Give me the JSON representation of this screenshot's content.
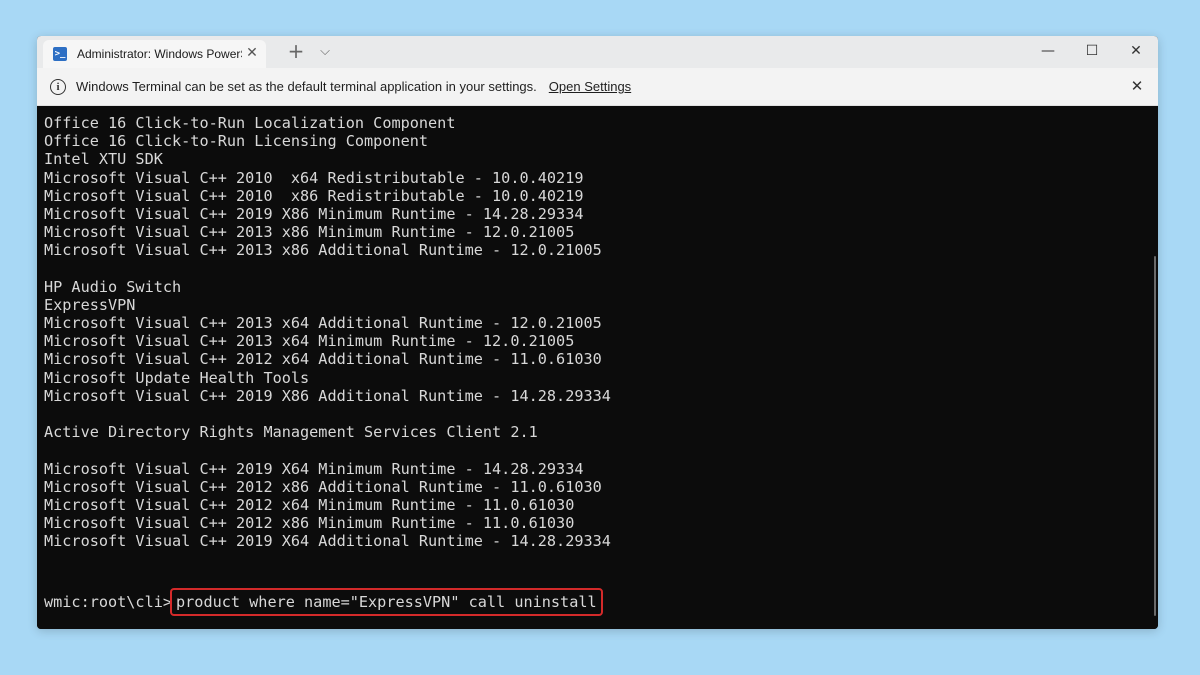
{
  "tab": {
    "title": "Administrator: Windows PowerShell",
    "close_glyph": "✕"
  },
  "titlebar": {
    "new_tab_glyph": "+",
    "dropdown_glyph": "⌵",
    "minimize_glyph": "—",
    "maximize_glyph": "☐",
    "close_glyph": "✕"
  },
  "infobar": {
    "icon_glyph": "i",
    "message": "Windows Terminal can be set as the default terminal application in your settings.",
    "link": "Open Settings",
    "close_glyph": "✕"
  },
  "terminal": {
    "lines": [
      "Office 16 Click-to-Run Localization Component",
      "Office 16 Click-to-Run Licensing Component",
      "Intel XTU SDK",
      "Microsoft Visual C++ 2010  x64 Redistributable - 10.0.40219",
      "Microsoft Visual C++ 2010  x86 Redistributable - 10.0.40219",
      "Microsoft Visual C++ 2019 X86 Minimum Runtime - 14.28.29334",
      "Microsoft Visual C++ 2013 x86 Minimum Runtime - 12.0.21005",
      "Microsoft Visual C++ 2013 x86 Additional Runtime - 12.0.21005",
      "",
      "HP Audio Switch",
      "ExpressVPN",
      "Microsoft Visual C++ 2013 x64 Additional Runtime - 12.0.21005",
      "Microsoft Visual C++ 2013 x64 Minimum Runtime - 12.0.21005",
      "Microsoft Visual C++ 2012 x64 Additional Runtime - 11.0.61030",
      "Microsoft Update Health Tools",
      "Microsoft Visual C++ 2019 X86 Additional Runtime - 14.28.29334",
      "",
      "Active Directory Rights Management Services Client 2.1",
      "",
      "Microsoft Visual C++ 2019 X64 Minimum Runtime - 14.28.29334",
      "Microsoft Visual C++ 2012 x86 Additional Runtime - 11.0.61030",
      "Microsoft Visual C++ 2012 x64 Minimum Runtime - 11.0.61030",
      "Microsoft Visual C++ 2012 x86 Minimum Runtime - 11.0.61030",
      "Microsoft Visual C++ 2019 X64 Additional Runtime - 14.28.29334"
    ],
    "prompt": "wmic:root\\cli>",
    "command": "product where name=\"ExpressVPN\" call uninstall"
  },
  "colors": {
    "background": "#a8d8f5",
    "terminal_bg": "#0c0c0c",
    "terminal_text": "#d8d8d8",
    "highlight_border": "#d42a2a",
    "powershell_icon": "#2d6fc4"
  },
  "icons": {
    "tab_icon": "powershell-icon",
    "info_icon": "info-icon"
  }
}
